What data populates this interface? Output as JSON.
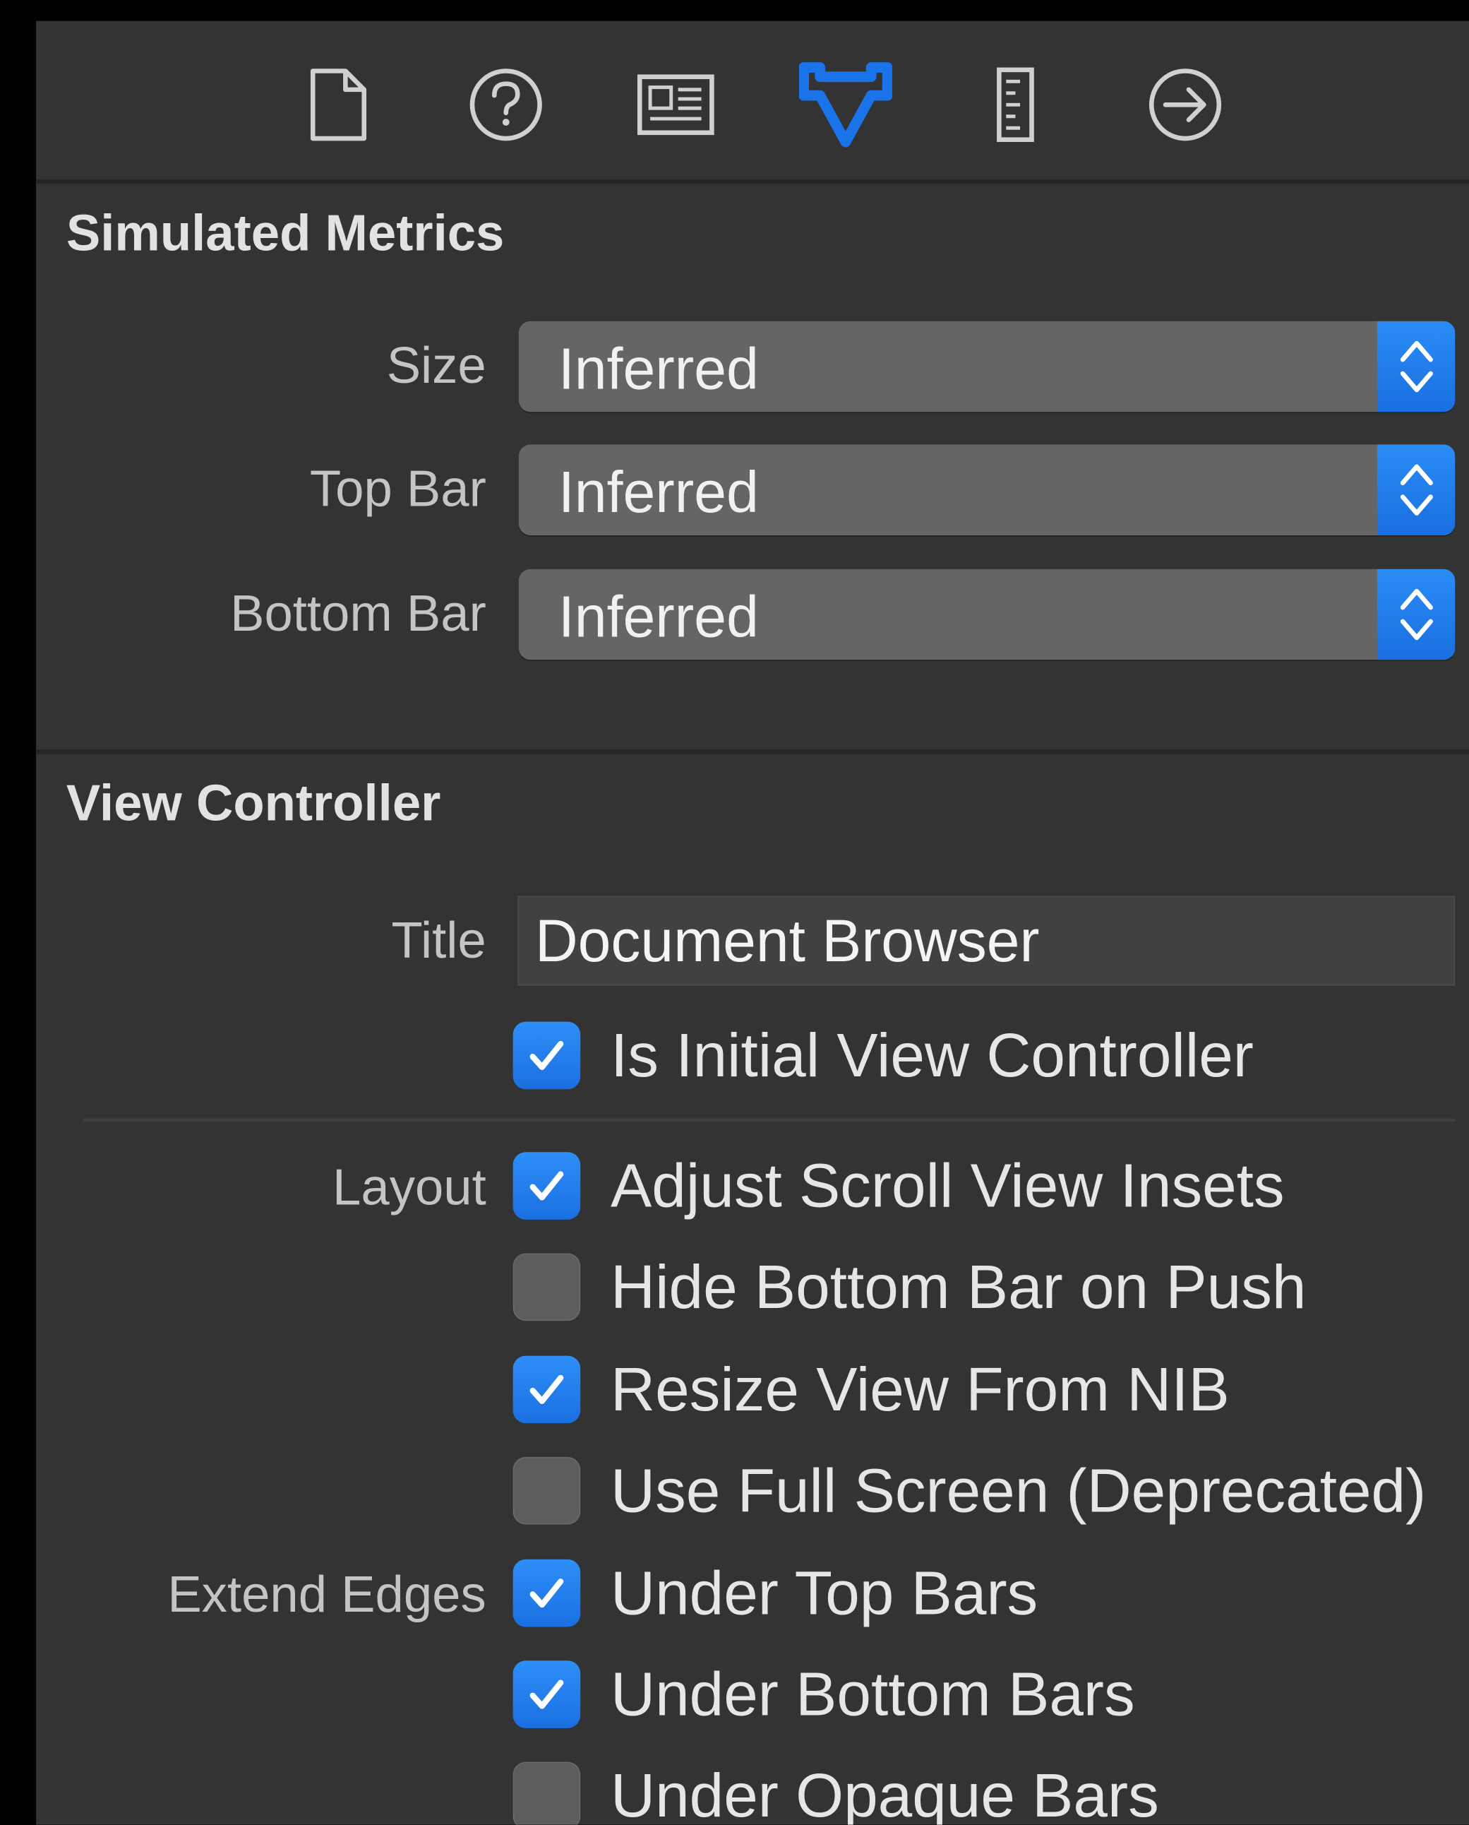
{
  "toolbar": {
    "icons": [
      {
        "name": "file-inspector-icon",
        "active": false
      },
      {
        "name": "quick-help-icon",
        "active": false
      },
      {
        "name": "identity-inspector-icon",
        "active": false
      },
      {
        "name": "attributes-inspector-icon",
        "active": true
      },
      {
        "name": "size-inspector-icon",
        "active": false
      },
      {
        "name": "connections-inspector-icon",
        "active": false
      }
    ],
    "accent": "#1a73e8",
    "icon_color": "#d0d0d0"
  },
  "simulated_metrics": {
    "title": "Simulated Metrics",
    "size": {
      "label": "Size",
      "value": "Inferred"
    },
    "top_bar": {
      "label": "Top Bar",
      "value": "Inferred"
    },
    "bottom_bar": {
      "label": "Bottom Bar",
      "value": "Inferred"
    }
  },
  "view_controller": {
    "title": "View Controller",
    "title_field": {
      "label": "Title",
      "value": "Document Browser"
    },
    "is_initial": {
      "label": "Is Initial View Controller",
      "checked": true
    },
    "layout_label": "Layout",
    "layout_options": [
      {
        "label": "Adjust Scroll View Insets",
        "checked": true
      },
      {
        "label": "Hide Bottom Bar on Push",
        "checked": false
      },
      {
        "label": "Resize View From NIB",
        "checked": true
      },
      {
        "label": "Use Full Screen (Deprecated)",
        "checked": false
      }
    ],
    "extend_edges_label": "Extend Edges",
    "extend_edges_options": [
      {
        "label": "Under Top Bars",
        "checked": true
      },
      {
        "label": "Under Bottom Bars",
        "checked": true
      },
      {
        "label": "Under Opaque Bars",
        "checked": false
      }
    ]
  }
}
